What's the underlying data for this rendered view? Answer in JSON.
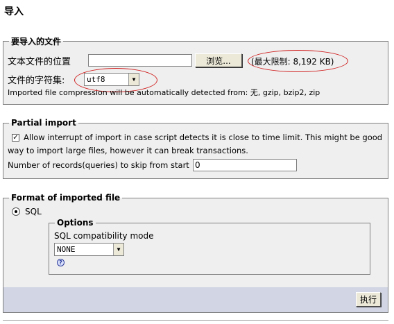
{
  "page": {
    "title": "导入"
  },
  "file_section": {
    "legend": "要导入的文件",
    "location_label": "文本文件的位置",
    "file_value": "",
    "browse_label": "浏览...",
    "max_limit": "(最大限制: 8,192 KB)",
    "charset_label": "文件的字符集:",
    "charset_value": "utf8",
    "compression_note": "Imported file compression will be automatically detected from: 无, gzip, bzip2, zip"
  },
  "partial_section": {
    "legend": "Partial import",
    "allow_interrupt_checked": true,
    "allow_interrupt_line1": "Allow interrupt of import in case script detects it is close to time limit. This might be good",
    "allow_interrupt_line2": "way to import large files, however it can break transactions.",
    "skip_label": "Number of records(queries) to skip from start",
    "skip_value": "0"
  },
  "format_section": {
    "legend": "Format of imported file",
    "format_option": "SQL",
    "format_selected": true,
    "options": {
      "legend": "Options",
      "compat_label": "SQL compatibility mode",
      "compat_value": "NONE"
    },
    "help_icon": "help-icon"
  },
  "footer": {
    "go_label": "执行"
  },
  "colors": {
    "panel_bg": "#efefef",
    "footer_bg": "#d2d6e4",
    "annotation_red": "#d02020"
  }
}
